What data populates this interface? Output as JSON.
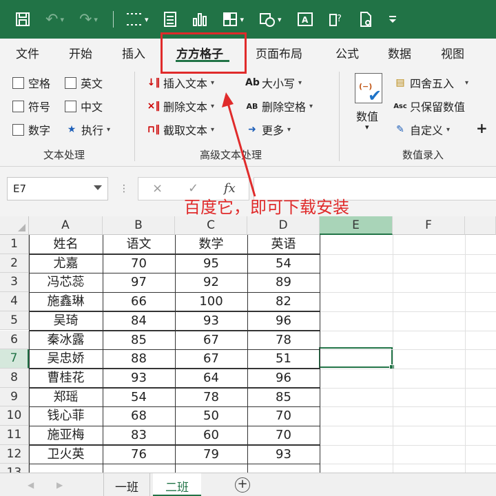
{
  "colors": {
    "brand_green": "#217346",
    "annotation_red": "#e02b2b"
  },
  "quick_access": {
    "icons": [
      "save-icon",
      "undo-icon",
      "redo-icon",
      "gridlines-icon",
      "form-icon",
      "chart-icon",
      "table-icon",
      "shapes-icon",
      "textbox-icon",
      "help-icon",
      "document-icon",
      "customize-icon"
    ]
  },
  "tabs": [
    "文件",
    "开始",
    "插入",
    "方方格子",
    "页面布局",
    "公式",
    "数据",
    "视图"
  ],
  "active_tab": "方方格子",
  "ribbon": {
    "text_group": {
      "checks": [
        "空格",
        "英文",
        "符号",
        "中文",
        "数字"
      ],
      "exec": "执行",
      "label": "文本处理"
    },
    "advanced_group": {
      "insert": "插入文本",
      "delete": "删除文本",
      "extract": "截取文本",
      "case": "大小写",
      "remove_spaces": "删除空格",
      "more": "更多",
      "case_icon": "Ab",
      "remove_spaces_icon": "AB",
      "label": "高级文本处理"
    },
    "numeric_group": {
      "value": "数值",
      "round": "四舍五入",
      "keep_values": "只保留数值",
      "custom": "自定义",
      "keep_values_icon": "Asc",
      "plus": "+",
      "label": "数值录入"
    }
  },
  "formula_bar": {
    "name_box": "E7",
    "cancel": "×",
    "enter": "✓",
    "fx": "fx",
    "dots": "⋮"
  },
  "annotation": "百度它，即可下载安装",
  "grid": {
    "columns": [
      "A",
      "B",
      "C",
      "D",
      "E",
      "F"
    ],
    "selected_column": "E",
    "selected_row": "7",
    "row_numbers": [
      "1",
      "2",
      "3",
      "4",
      "5",
      "6",
      "7",
      "8",
      "9",
      "10",
      "11",
      "12",
      "13"
    ],
    "header": [
      "姓名",
      "语文",
      "数学",
      "英语"
    ],
    "rows": [
      [
        "尤嘉",
        "70",
        "95",
        "54"
      ],
      [
        "冯芯蕊",
        "97",
        "92",
        "89"
      ],
      [
        "施鑫琳",
        "66",
        "100",
        "82"
      ],
      [
        "吴琦",
        "84",
        "93",
        "96"
      ],
      [
        "秦冰露",
        "85",
        "67",
        "78"
      ],
      [
        "吴忠娇",
        "88",
        "67",
        "51"
      ],
      [
        "曹桂花",
        "93",
        "64",
        "96"
      ],
      [
        "郑瑶",
        "54",
        "78",
        "85"
      ],
      [
        "钱心菲",
        "68",
        "50",
        "70"
      ],
      [
        "施亚梅",
        "83",
        "60",
        "70"
      ],
      [
        "卫火英",
        "76",
        "79",
        "93"
      ]
    ]
  },
  "sheet_tabs": [
    "一班",
    "二班"
  ],
  "active_sheet": "二班"
}
